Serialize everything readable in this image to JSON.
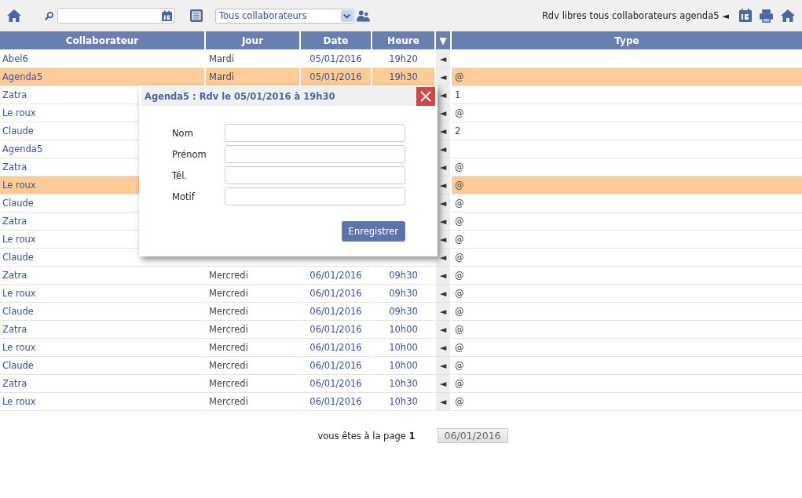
{
  "toolbar": {
    "collaborator_select": {
      "value": "Tous collaborateurs"
    },
    "title": "Rdv libres tous collaborateurs agenda5",
    "title_arrow": "◄"
  },
  "table": {
    "columns": [
      "Collaborateur",
      "Jour",
      "Date",
      "Heure",
      "▼",
      "Type"
    ],
    "rows": [
      {
        "collaborateur": "Abel6",
        "jour": "Mardi",
        "date": "05/01/2016",
        "heure": "19h20",
        "action": "◄",
        "type": "",
        "selected": false
      },
      {
        "collaborateur": "Agenda5",
        "jour": "Mardi",
        "date": "05/01/2016",
        "heure": "19h30",
        "action": "◄",
        "type": "@",
        "selected": true
      },
      {
        "collaborateur": "Zatra",
        "action": "◄",
        "type": "1",
        "selected": false
      },
      {
        "collaborateur": "Le roux",
        "action": "◄",
        "type": "@",
        "selected": false
      },
      {
        "collaborateur": "Claude",
        "action": "◄",
        "type": "2",
        "selected": false
      },
      {
        "collaborateur": "Agenda5",
        "action": "◄",
        "type": "",
        "selected": false
      },
      {
        "collaborateur": "Zatra",
        "action": "◄",
        "type": "@",
        "selected": false
      },
      {
        "collaborateur": "Le roux",
        "action": "◄",
        "type": "@",
        "selected": true
      },
      {
        "collaborateur": "Claude",
        "action": "◄",
        "type": "@",
        "selected": false
      },
      {
        "collaborateur": "Zatra",
        "action": "◄",
        "type": "@",
        "selected": false
      },
      {
        "collaborateur": "Le roux",
        "action": "◄",
        "type": "@",
        "selected": false
      },
      {
        "collaborateur": "Claude",
        "action": "◄",
        "type": "@",
        "selected": false
      },
      {
        "collaborateur": "Zatra",
        "jour": "Mercredi",
        "date": "06/01/2016",
        "heure": "09h30",
        "action": "◄",
        "type": "@",
        "selected": false
      },
      {
        "collaborateur": "Le roux",
        "jour": "Mercredi",
        "date": "06/01/2016",
        "heure": "09h30",
        "action": "◄",
        "type": "@",
        "selected": false
      },
      {
        "collaborateur": "Claude",
        "jour": "Mercredi",
        "date": "06/01/2016",
        "heure": "09h30",
        "action": "◄",
        "type": "@",
        "selected": false
      },
      {
        "collaborateur": "Zatra",
        "jour": "Mercredi",
        "date": "06/01/2016",
        "heure": "10h00",
        "action": "◄",
        "type": "@",
        "selected": false
      },
      {
        "collaborateur": "Le roux",
        "jour": "Mercredi",
        "date": "06/01/2016",
        "heure": "10h00",
        "action": "◄",
        "type": "@",
        "selected": false
      },
      {
        "collaborateur": "Claude",
        "jour": "Mercredi",
        "date": "06/01/2016",
        "heure": "10h00",
        "action": "◄",
        "type": "@",
        "selected": false
      },
      {
        "collaborateur": "Zatra",
        "jour": "Mercredi",
        "date": "06/01/2016",
        "heure": "10h30",
        "action": "◄",
        "type": "@",
        "selected": false
      },
      {
        "collaborateur": "Le roux",
        "jour": "Mercredi",
        "date": "06/01/2016",
        "heure": "10h30",
        "action": "◄",
        "type": "@",
        "selected": false
      }
    ]
  },
  "pagination": {
    "text": "vous êtes à la page **1**",
    "next_button": "06/01/2016"
  },
  "dialog": {
    "title": "Agenda5 : Rdv le 05/01/2016 à 19h30",
    "fields": [
      {
        "label": "Nom"
      },
      {
        "label": "Prénom"
      },
      {
        "label": "Tél."
      },
      {
        "label": "Motif"
      }
    ],
    "submit": "Enregistrer"
  }
}
